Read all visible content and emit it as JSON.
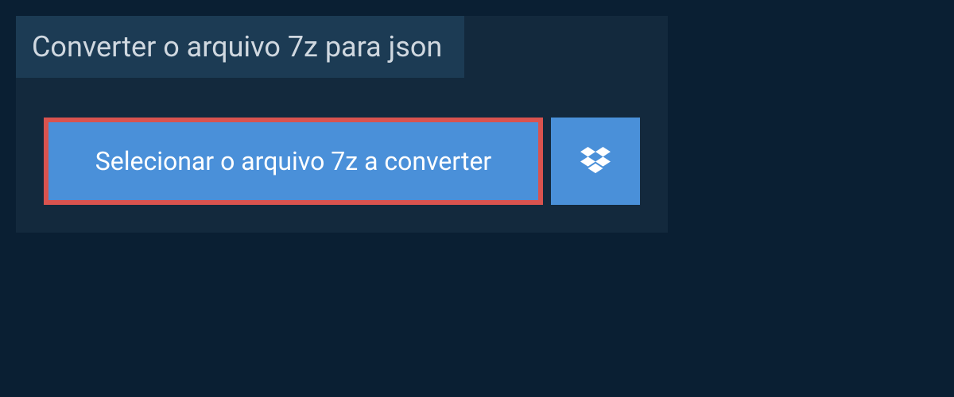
{
  "header": {
    "title": "Converter o arquivo 7z para json"
  },
  "actions": {
    "select_file_label": "Selecionar o arquivo 7z a converter",
    "dropbox_icon": "dropbox"
  },
  "colors": {
    "page_bg": "#0a1f33",
    "panel_bg": "#13293d",
    "title_bar_bg": "#1c3b54",
    "button_bg": "#4a90d9",
    "button_border": "#d9534f"
  }
}
